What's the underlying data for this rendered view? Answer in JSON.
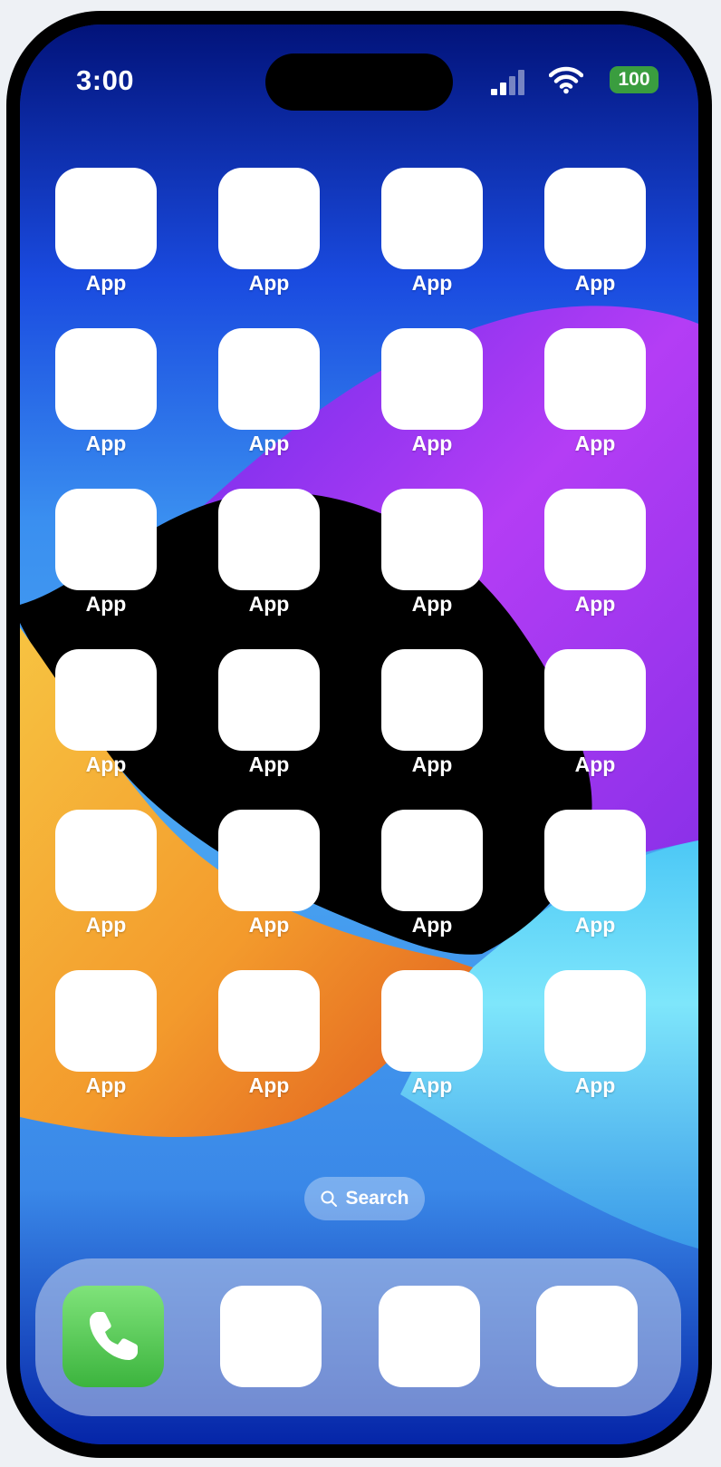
{
  "status_bar": {
    "time": "3:00",
    "battery_level": "100",
    "signal_bars_filled": 2,
    "signal_bars_total": 4,
    "wifi_icon": "wifi-icon",
    "battery_color": "#3a9d3f"
  },
  "home_screen": {
    "apps": [
      {
        "label": "App"
      },
      {
        "label": "App"
      },
      {
        "label": "App"
      },
      {
        "label": "App"
      },
      {
        "label": "App"
      },
      {
        "label": "App"
      },
      {
        "label": "App"
      },
      {
        "label": "App"
      },
      {
        "label": "App"
      },
      {
        "label": "App"
      },
      {
        "label": "App"
      },
      {
        "label": "App"
      },
      {
        "label": "App"
      },
      {
        "label": "App"
      },
      {
        "label": "App"
      },
      {
        "label": "App"
      },
      {
        "label": "App"
      },
      {
        "label": "App"
      },
      {
        "label": "App"
      },
      {
        "label": "App"
      },
      {
        "label": "App"
      },
      {
        "label": "App"
      },
      {
        "label": "App"
      },
      {
        "label": "App"
      }
    ]
  },
  "search": {
    "label": "Search",
    "icon": "search-icon"
  },
  "dock": {
    "apps": [
      {
        "icon": "phone-icon",
        "color": "#4cc24a"
      },
      {
        "icon": "blank-app-icon"
      },
      {
        "icon": "blank-app-icon"
      },
      {
        "icon": "blank-app-icon"
      }
    ]
  },
  "colors": {
    "wallpaper_blue": "#0a2fb8",
    "wallpaper_purple": "#a43cf2",
    "wallpaper_cyan": "#7ee6fb",
    "wallpaper_orange": "#f39a2c",
    "wallpaper_black": "#000000"
  }
}
